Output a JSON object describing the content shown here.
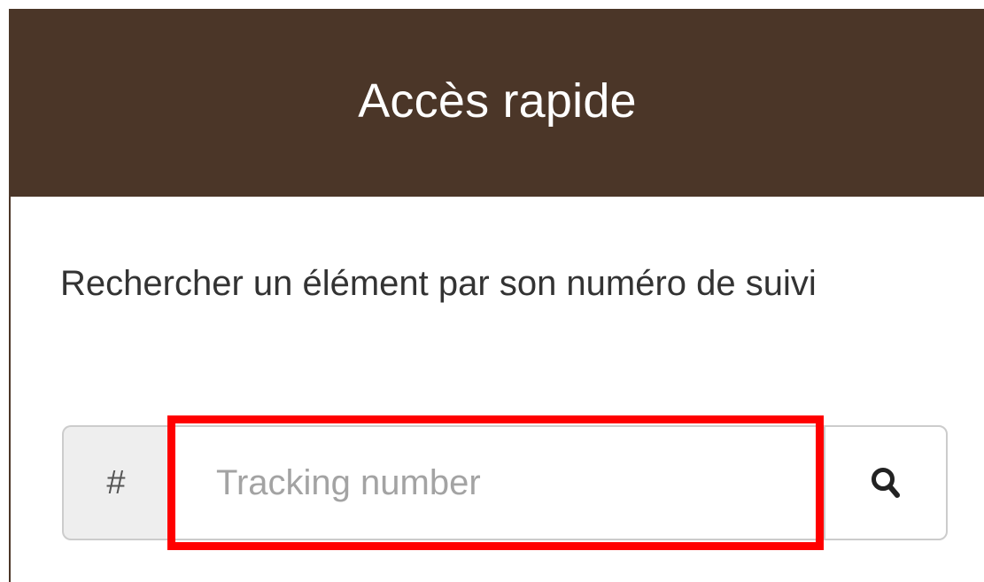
{
  "panel": {
    "title": "Accès rapide",
    "description": "Rechercher un élément par son numéro de suivi",
    "colors": {
      "header_bg": "#4b3628",
      "highlight": "#ff0000"
    }
  },
  "search": {
    "prefix": "#",
    "placeholder": "Tracking number",
    "value": "",
    "button_icon": "search-icon"
  }
}
